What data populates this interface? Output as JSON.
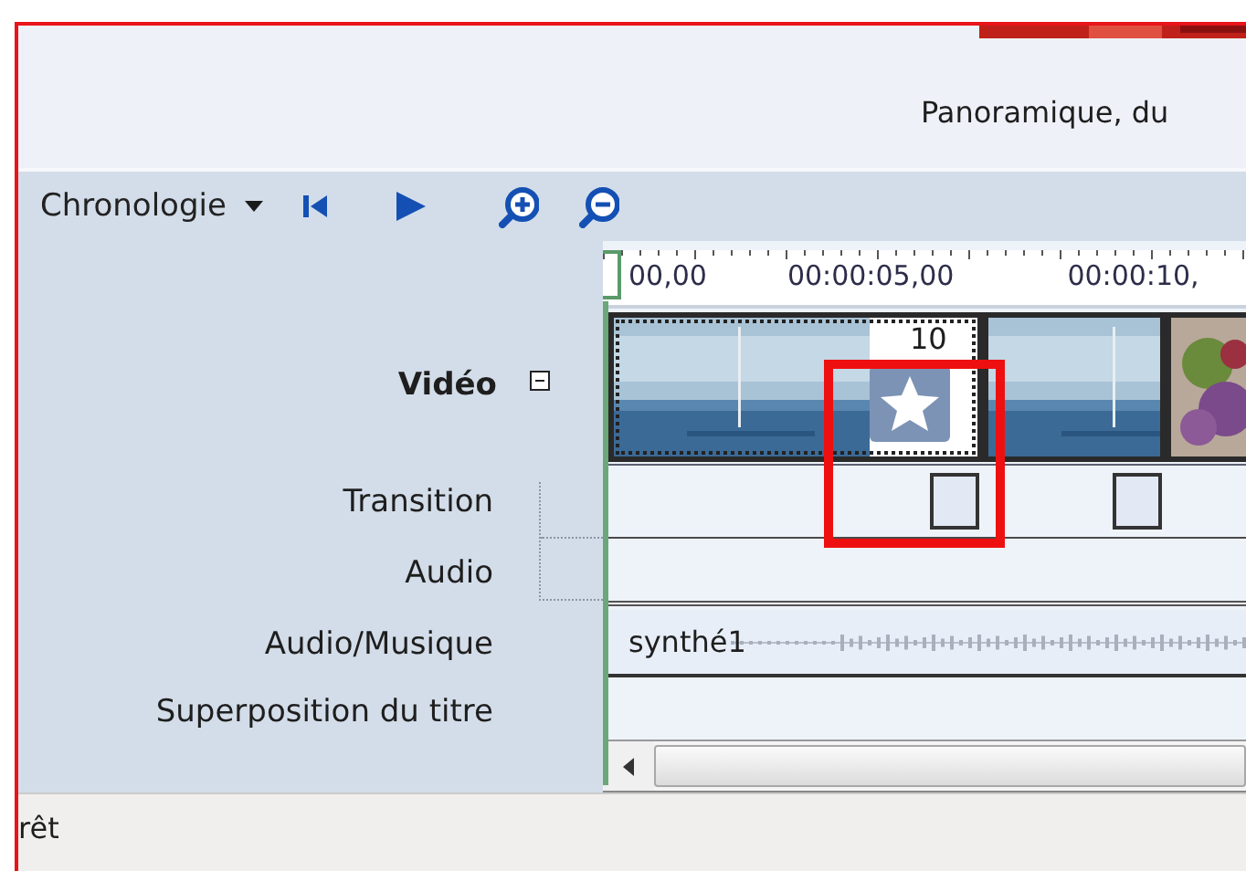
{
  "header": {
    "subtitle": "Panoramique, du"
  },
  "toolbar": {
    "view_menu": "Chronologie"
  },
  "ruler": {
    "ticks": [
      "00,00",
      "00:00:05,00",
      "00:00:10,"
    ]
  },
  "tracks": [
    {
      "label": "Vidéo",
      "kind": "video",
      "expanded": true
    },
    {
      "label": "Transition",
      "kind": "transition"
    },
    {
      "label": "Audio",
      "kind": "audio"
    },
    {
      "label": "Audio/Musique",
      "kind": "music",
      "clip": "synthé1"
    },
    {
      "label": "Superposition du titre",
      "kind": "title"
    }
  ],
  "video_clips": [
    {
      "kind": "sea",
      "selected": true,
      "duration": "10",
      "effect": true
    },
    {
      "kind": "sea",
      "selected": false
    },
    {
      "kind": "flowers",
      "selected": false
    }
  ],
  "status_bar": {
    "text": "rêt"
  }
}
